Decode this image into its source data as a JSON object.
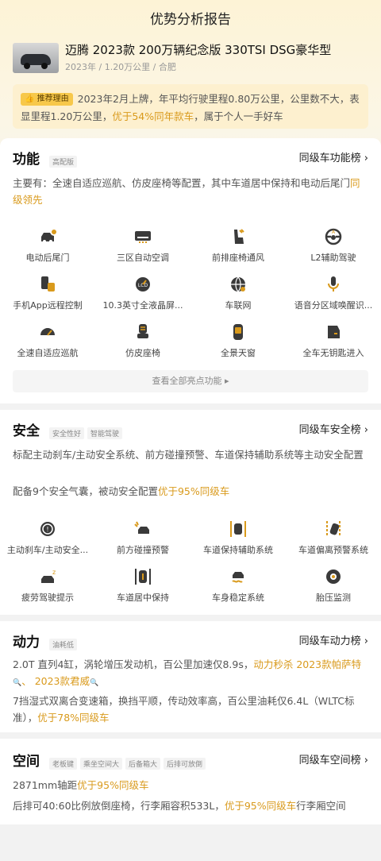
{
  "page": {
    "title": "优势分析报告"
  },
  "car": {
    "name": "迈腾 2023款 200万辆纪念版 330TSI DSG豪华型",
    "meta": "2023年 / 1.20万公里 / 合肥"
  },
  "reason": {
    "tag": "推荐理由",
    "text1": "2023年2月上牌，年平均行驶里程0.80万公里，公里数不大，表显里程1.20万公里，",
    "highlight": "优于54%同年款车",
    "text2": "，属于个人一手好车"
  },
  "function": {
    "title": "功能",
    "chips": [
      "高配版"
    ],
    "rank": "同级车功能榜 ›",
    "desc1": "主要有：全速自适应巡航、仿皮座椅等配置，其中车道居中保持和电动后尾门",
    "desc_hl": "同级领先",
    "items": [
      "电动后尾门",
      "三区自动空调",
      "前排座椅通风",
      "L2辅助驾驶",
      "手机App远程控制",
      "10.3英寸全液晶屏...",
      "车联网",
      "语音分区域唤醒识...",
      "全速自适应巡航",
      "仿皮座椅",
      "全景天窗",
      "全车无钥匙进入"
    ],
    "more": "查看全部亮点功能 ▸"
  },
  "safety": {
    "title": "安全",
    "chips": [
      "安全性好",
      "智能驾驶"
    ],
    "rank": "同级车安全榜 ›",
    "desc1": "标配主动刹车/主动安全系统、前方碰撞预警、车道保持辅助系统等主动安全配置",
    "desc2a": "配备9个安全气囊，被动安全配置",
    "desc2_hl": "优于95%同级车",
    "items": [
      "主动刹车/主动安全...",
      "前方碰撞预警",
      "车道保持辅助系统",
      "车道偏离预警系统",
      "疲劳驾驶提示",
      "车道居中保持",
      "车身稳定系统",
      "胎压监测"
    ]
  },
  "power": {
    "title": "动力",
    "chips": [
      "油耗低"
    ],
    "rank": "同级车动力榜 ›",
    "desc1a": "2.0T 直列4缸，涡轮增压发动机，百公里加速仅8.9s，",
    "desc1_hl": "动力秒杀 2023款帕萨特",
    "desc1_hl2": "、 2023款君威",
    "desc2a": "7挡湿式双离合变速箱，换挡平顺，传动效率高，百公里油耗仅6.4L（WLTC标准），",
    "desc2_hl": "优于78%同级车"
  },
  "space": {
    "title": "空间",
    "chips": [
      "老板键",
      "乘坐空间大",
      "后备箱大",
      "后排可放倒"
    ],
    "rank": "同级车空间榜 ›",
    "desc1a": "2871mm轴距",
    "desc1_hl": "优于95%同级车",
    "desc2a": "后排可40:60比例放倒座椅，行李厢容积533L，",
    "desc2_hl": "优于95%同级车",
    "desc2b": "行李厢空间"
  },
  "colors": {
    "accent": "#d99a1c",
    "tag": "#f7c84a",
    "icon": "#3a3a3a"
  }
}
